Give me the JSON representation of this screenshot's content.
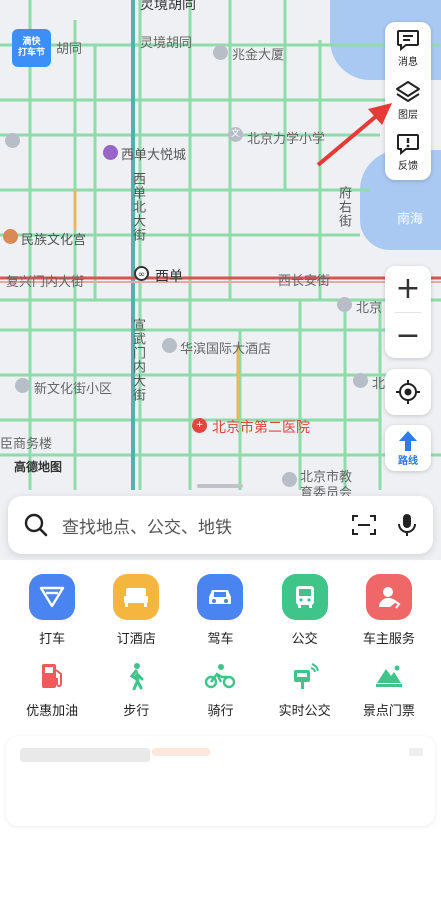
{
  "map": {
    "labels": {
      "linjing_hutong_top": "灵境胡同",
      "hutong_left": "胡同",
      "linjing_hutong": "灵境胡同",
      "zhaojin_building": "兆金大厦",
      "lixue_school": "北京力学小学",
      "xidan_joy_city": "西单大悦城",
      "fuyou_street": "府右街",
      "xidan_north_street": "西单北大街",
      "minzu_palace": "民族文化宫",
      "nanhai": "南海",
      "fuxingmen_inner_street": "复兴门内大街",
      "xidan_station": "西单",
      "xichangan_street": "西长安街",
      "beijing_right": "北京",
      "huabin_hotel": "华滨国际大酒店",
      "xuanwumen_inner_street": "宣武门内大街",
      "xinwenhua_community": "新文化街小区",
      "north_right": "北",
      "second_hospital": "北京市第二医院",
      "commerce_bldg": "臣商务楼",
      "beijing_edu_committee_1": "北京市教",
      "beijing_edu_committee_2": "育委员会"
    },
    "logo": "高德地图",
    "badge": [
      "滴快",
      "打车节"
    ]
  },
  "controls": {
    "messages": "消息",
    "layers": "图层",
    "feedback": "反馈",
    "zoom_in": "+",
    "zoom_out": "−",
    "route": "路线"
  },
  "search": {
    "placeholder": "查找地点、公交、地铁"
  },
  "services_row1": [
    {
      "label": "打车",
      "icon": "taxi-icon",
      "color": "#4a84f0"
    },
    {
      "label": "订酒店",
      "icon": "hotel-bed-icon",
      "color": "#f4b63f"
    },
    {
      "label": "驾车",
      "icon": "car-icon",
      "color": "#4a84f0"
    },
    {
      "label": "公交",
      "icon": "bus-icon",
      "color": "#3fc48a"
    },
    {
      "label": "车主服务",
      "icon": "car-owner-icon",
      "color": "#ef6767"
    }
  ],
  "services_row2": [
    {
      "label": "优惠加油",
      "icon": "fuel-icon",
      "color": "#ef5b5b"
    },
    {
      "label": "步行",
      "icon": "walk-icon",
      "color": "#3fc48a"
    },
    {
      "label": "骑行",
      "icon": "bike-icon",
      "color": "#3fc48a"
    },
    {
      "label": "实时公交",
      "icon": "realtime-bus-icon",
      "color": "#3fc48a"
    },
    {
      "label": "景点门票",
      "icon": "scenic-ticket-icon",
      "color": "#3fc48a"
    }
  ],
  "colors": {
    "road_green": "#8fdcab",
    "subway_teal": "#53b3ac",
    "main_road_red": "#d9534f",
    "lake_blue": "#a9c8f2",
    "accent_blue": "#2f7be9",
    "arrow_red": "#e53a35"
  }
}
